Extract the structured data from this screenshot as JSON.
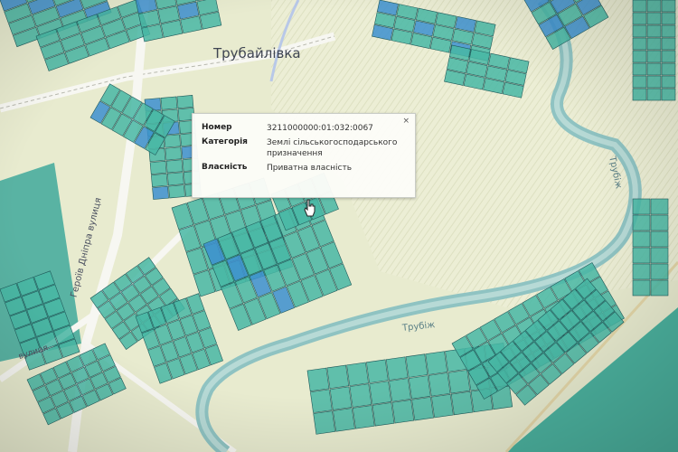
{
  "map": {
    "place_label": "Трубайлівка",
    "street_label_1": "Героїв Дніпра вулиця",
    "street_label_2": "вулиця",
    "river_label_1": "Трубіж",
    "river_label_2": "Трубіж",
    "colors": {
      "background": "#e9ecd0",
      "parcel_private": "#48b7a5",
      "parcel_blue": "#3c8fcf",
      "parcel_stroke": "#1f5a5a",
      "river": "#8fc3c2",
      "road": "#ffffff"
    }
  },
  "popup": {
    "close_label": "×",
    "rows": [
      {
        "key": "Номер",
        "value": "3211000000:01:032:0067"
      },
      {
        "key": "Категорія",
        "value": "Землі сільськогосподарського призначення"
      },
      {
        "key": "Власність",
        "value": "Приватна власність"
      }
    ]
  },
  "cursor": {
    "icon": "hand-pointer-icon"
  }
}
